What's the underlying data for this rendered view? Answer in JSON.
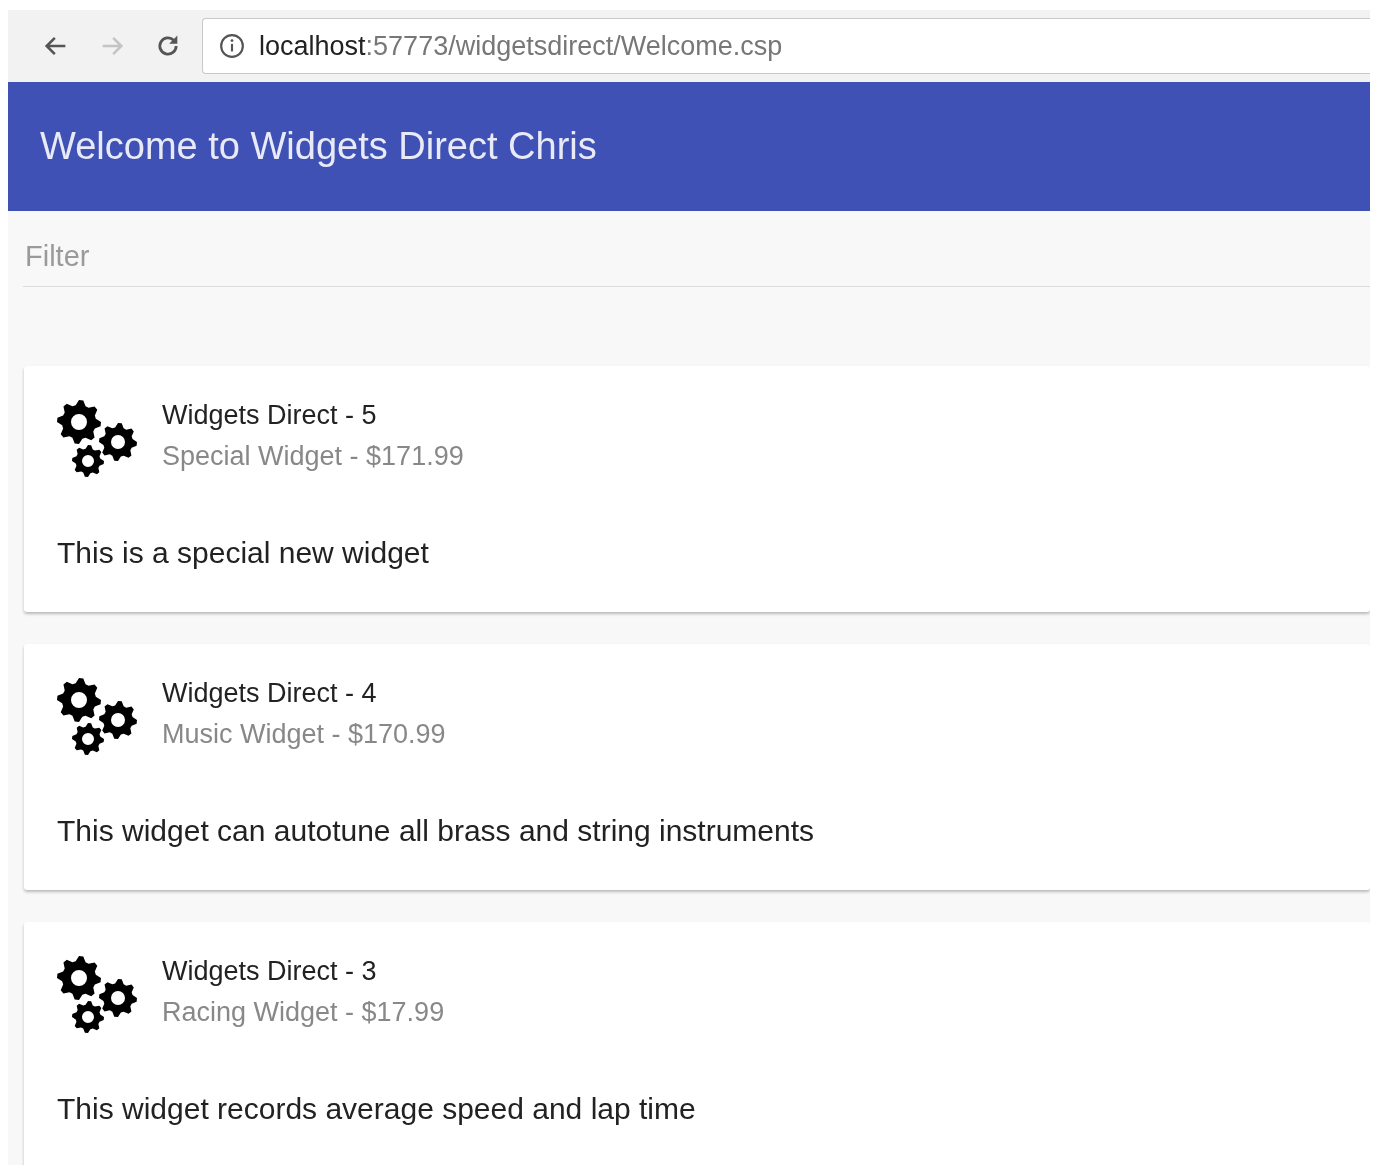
{
  "browser": {
    "nav_buttons": [
      {
        "kind": "back",
        "disabled": false
      },
      {
        "kind": "forward",
        "disabled": true
      },
      {
        "kind": "reload",
        "disabled": false
      }
    ],
    "url_host": "localhost",
    "url_path": ":57773/widgetsdirect/Welcome.csp"
  },
  "header": {
    "title": "Welcome to Widgets Direct Chris"
  },
  "filter": {
    "placeholder": "Filter"
  },
  "cards": [
    {
      "title": "Widgets Direct - 5",
      "subtitle": "Special Widget - $171.99",
      "description": "This is a special new widget"
    },
    {
      "title": "Widgets Direct - 4",
      "subtitle": "Music Widget - $170.99",
      "description": "This widget can autotune all brass and string instruments"
    },
    {
      "title": "Widgets Direct - 3",
      "subtitle": "Racing Widget - $17.99",
      "description": "This widget records average speed and lap time"
    }
  ]
}
